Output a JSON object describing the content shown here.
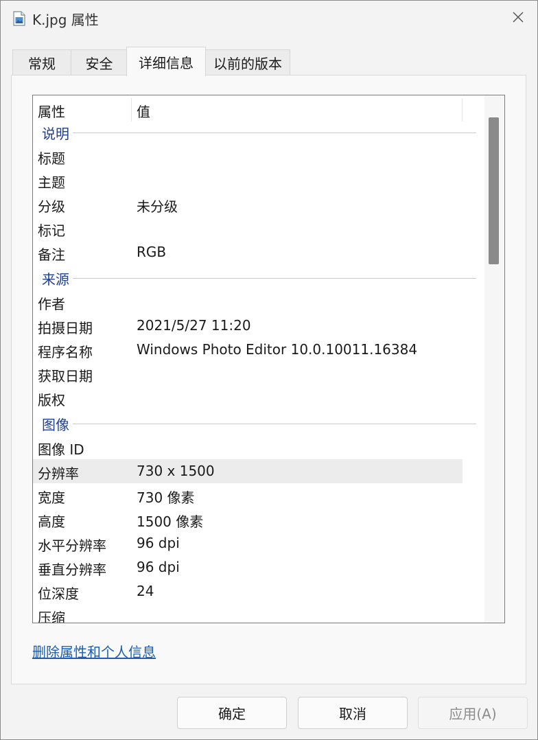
{
  "window": {
    "title": "K.jpg 属性",
    "close_icon": "close-icon"
  },
  "tabs": [
    {
      "label": "常规",
      "active": false
    },
    {
      "label": "安全",
      "active": false
    },
    {
      "label": "详细信息",
      "active": true
    },
    {
      "label": "以前的版本",
      "active": false
    }
  ],
  "table": {
    "headers": {
      "property": "属性",
      "value": "值"
    },
    "groups": [
      {
        "name": "说明",
        "rows": [
          {
            "k": "标题",
            "v": ""
          },
          {
            "k": "主题",
            "v": ""
          },
          {
            "k": "分级",
            "v": "未分级"
          },
          {
            "k": "标记",
            "v": ""
          },
          {
            "k": "备注",
            "v": "RGB"
          }
        ]
      },
      {
        "name": "来源",
        "rows": [
          {
            "k": "作者",
            "v": ""
          },
          {
            "k": "拍摄日期",
            "v": "2021/5/27 11:20"
          },
          {
            "k": "程序名称",
            "v": "Windows Photo Editor 10.0.10011.16384"
          },
          {
            "k": "获取日期",
            "v": ""
          },
          {
            "k": "版权",
            "v": ""
          }
        ]
      },
      {
        "name": "图像",
        "rows": [
          {
            "k": "图像 ID",
            "v": ""
          },
          {
            "k": "分辨率",
            "v": "730 x 1500",
            "selected": true
          },
          {
            "k": "宽度",
            "v": "730 像素"
          },
          {
            "k": "高度",
            "v": "1500 像素"
          },
          {
            "k": "水平分辨率",
            "v": "96 dpi"
          },
          {
            "k": "垂直分辨率",
            "v": "96 dpi"
          },
          {
            "k": "位深度",
            "v": "24"
          },
          {
            "k": "压缩",
            "v": ""
          }
        ]
      }
    ]
  },
  "link": {
    "label": "删除属性和个人信息"
  },
  "buttons": {
    "ok": "确定",
    "cancel": "取消",
    "apply": "应用(A)"
  },
  "colors": {
    "group_header": "#1f3f8f",
    "link": "#1a5fb4",
    "selected_row": "#ececec"
  }
}
